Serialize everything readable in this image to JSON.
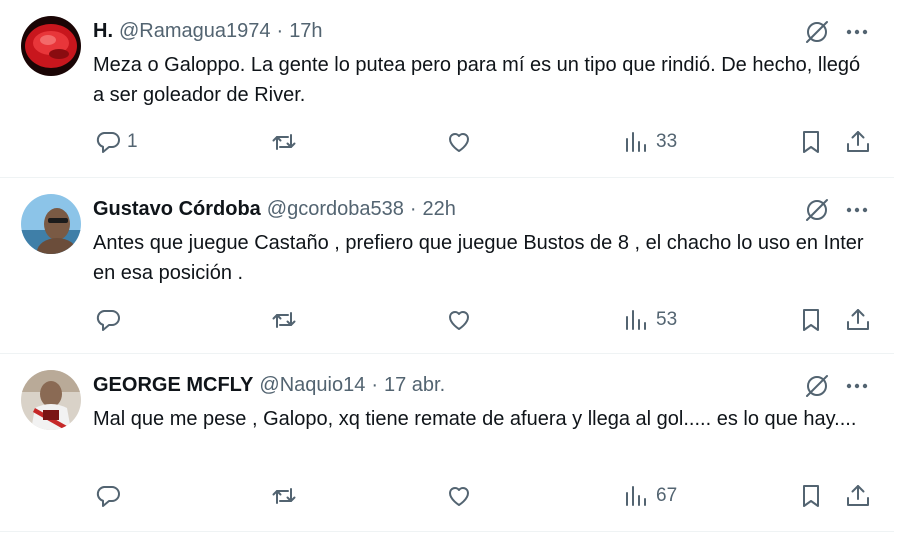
{
  "tweets": [
    {
      "name": "H.",
      "handle": "@Ramagua1974",
      "separator": "·",
      "time": "17h",
      "text": "Meza o Galoppo. La gente lo putea pero para mí es un tipo que rindió. De hecho, llegó a ser goleador de River.",
      "replies": "1",
      "views": "33",
      "avatar_color": "#c8161d"
    },
    {
      "name": "Gustavo Córdoba",
      "handle": "@gcordoba538",
      "separator": "·",
      "time": "22h",
      "text": "Antes que juegue Castaño , prefiero que juegue Bustos de 8 , el chacho lo uso en Inter en esa posición .",
      "replies": "",
      "views": "53",
      "avatar_color": "#7fb6d8"
    },
    {
      "name": "GEORGE MCFLY",
      "handle": "@Naquio14",
      "separator": "·",
      "time": "17 abr.",
      "text": "Mal que me pese , Galopo, xq tiene remate de afuera y llega al gol..... es lo que hay....",
      "replies": "",
      "views": "67",
      "avatar_color": "#9a2a2a"
    }
  ],
  "icons": [
    "grok-icon",
    "more-icon",
    "reply-icon",
    "retweet-icon",
    "like-icon",
    "views-icon",
    "bookmark-icon",
    "share-icon"
  ],
  "colors": {
    "text": "#0f1419",
    "secondary": "#536471",
    "divider": "#eff3f4"
  }
}
